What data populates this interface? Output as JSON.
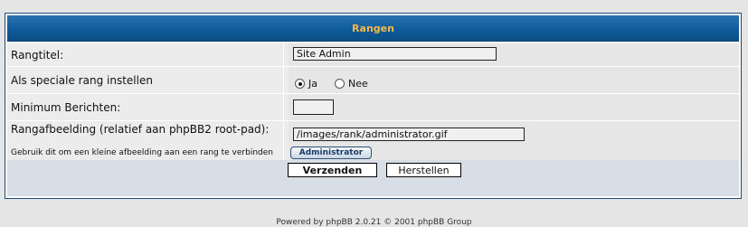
{
  "panel": {
    "title": "Rangen"
  },
  "fields": {
    "rank_title": {
      "label": "Rangtitel:",
      "value": "Site Admin"
    },
    "special_rank": {
      "label": "Als speciale rang instellen",
      "options": [
        {
          "label": "Ja",
          "selected": true
        },
        {
          "label": "Nee",
          "selected": false
        }
      ]
    },
    "min_posts": {
      "label": "Minimum Berichten:",
      "value": ""
    },
    "rank_image": {
      "label": "Rangafbeelding (relatief aan phpBB2 root-pad):",
      "hint": "Gebruik dit om een kleine afbeelding aan een rang te verbinden",
      "value": "/images/rank/administrator.gif",
      "preview_label": "Administrator"
    }
  },
  "actions": {
    "submit_label": "Verzenden",
    "reset_label": "Herstellen"
  },
  "footer": {
    "text": "Powered by phpBB 2.0.21 © 2001 phpBB Group"
  },
  "colors": {
    "header_bg": "#0e5a98",
    "header_text": "#f7b94a",
    "border": "#1b4f7e"
  }
}
